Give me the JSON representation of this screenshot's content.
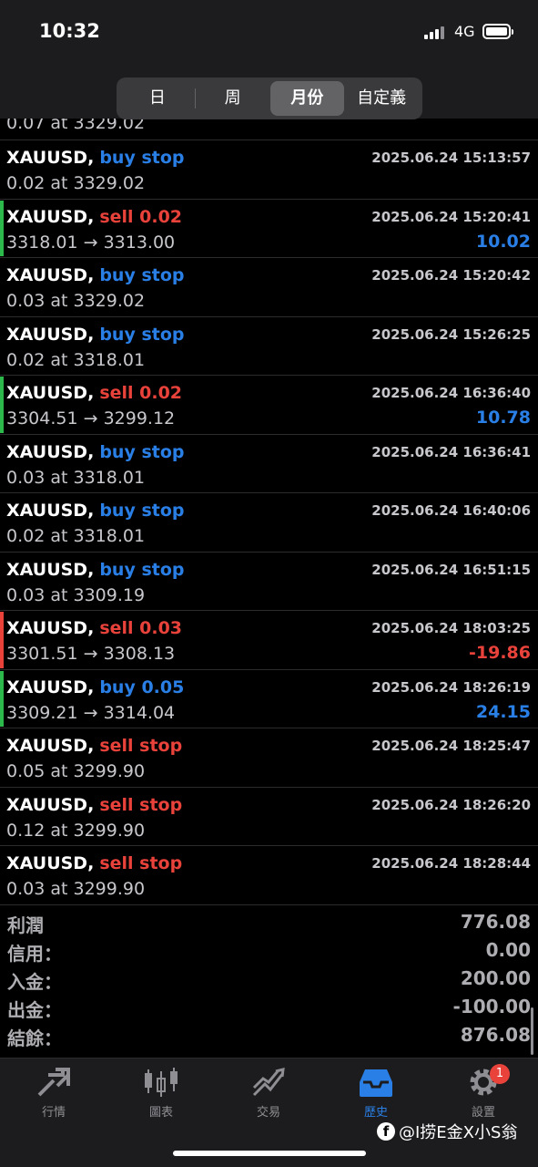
{
  "status_bar": {
    "time": "10:32",
    "network": "4G"
  },
  "period_tabs": [
    {
      "label": "日",
      "active": false
    },
    {
      "label": "周",
      "active": false
    },
    {
      "label": "月份",
      "active": true
    },
    {
      "label": "自定義",
      "active": false
    }
  ],
  "partial_row": {
    "detail": "0.07 at 3329.02"
  },
  "orders": [
    {
      "symbol": "XAUUSD,",
      "type": "buy stop",
      "type_color": "blue",
      "date": "2025.06.24 15:13:57",
      "detail": "0.02 at 3329.02",
      "profit": "",
      "bar": ""
    },
    {
      "symbol": "XAUUSD,",
      "type": "sell 0.02",
      "type_color": "red",
      "date": "2025.06.24 15:20:41",
      "detail": "3318.01 → 3313.00",
      "profit": "10.02",
      "profit_color": "blue",
      "bar": "#2db84c"
    },
    {
      "symbol": "XAUUSD,",
      "type": "buy stop",
      "type_color": "blue",
      "date": "2025.06.24 15:20:42",
      "detail": "0.03 at 3329.02",
      "profit": "",
      "bar": ""
    },
    {
      "symbol": "XAUUSD,",
      "type": "buy stop",
      "type_color": "blue",
      "date": "2025.06.24 15:26:25",
      "detail": "0.02 at 3318.01",
      "profit": "",
      "bar": ""
    },
    {
      "symbol": "XAUUSD,",
      "type": "sell 0.02",
      "type_color": "red",
      "date": "2025.06.24 16:36:40",
      "detail": "3304.51 → 3299.12",
      "profit": "10.78",
      "profit_color": "blue",
      "bar": "#2db84c"
    },
    {
      "symbol": "XAUUSD,",
      "type": "buy stop",
      "type_color": "blue",
      "date": "2025.06.24 16:36:41",
      "detail": "0.03 at 3318.01",
      "profit": "",
      "bar": ""
    },
    {
      "symbol": "XAUUSD,",
      "type": "buy stop",
      "type_color": "blue",
      "date": "2025.06.24 16:40:06",
      "detail": "0.02 at 3318.01",
      "profit": "",
      "bar": ""
    },
    {
      "symbol": "XAUUSD,",
      "type": "buy stop",
      "type_color": "blue",
      "date": "2025.06.24 16:51:15",
      "detail": "0.03 at 3309.19",
      "profit": "",
      "bar": ""
    },
    {
      "symbol": "XAUUSD,",
      "type": "sell 0.03",
      "type_color": "red",
      "date": "2025.06.24 18:03:25",
      "detail": "3301.51 → 3308.13",
      "profit": "-19.86",
      "profit_color": "red",
      "bar": "#e8423b"
    },
    {
      "symbol": "XAUUSD,",
      "type": "buy 0.05",
      "type_color": "blue",
      "date": "2025.06.24 18:26:19",
      "detail": "3309.21 → 3314.04",
      "profit": "24.15",
      "profit_color": "blue",
      "bar": "#2db84c"
    },
    {
      "symbol": "XAUUSD,",
      "type": "sell stop",
      "type_color": "red",
      "date": "2025.06.24 18:25:47",
      "detail": "0.05 at 3299.90",
      "profit": "",
      "bar": ""
    },
    {
      "symbol": "XAUUSD,",
      "type": "sell stop",
      "type_color": "red",
      "date": "2025.06.24 18:26:20",
      "detail": "0.12 at 3299.90",
      "profit": "",
      "bar": ""
    },
    {
      "symbol": "XAUUSD,",
      "type": "sell stop",
      "type_color": "red",
      "date": "2025.06.24 18:28:44",
      "detail": "0.03 at 3299.90",
      "profit": "",
      "bar": ""
    }
  ],
  "summary": [
    {
      "label": "利潤",
      "value": "776.08"
    },
    {
      "label": "信用：",
      "value": "0.00"
    },
    {
      "label": "入金：",
      "value": "200.00"
    },
    {
      "label": "出金：",
      "value": "-100.00"
    },
    {
      "label": "結餘：",
      "value": "876.08"
    }
  ],
  "tabbar": {
    "items": [
      {
        "label": "行情",
        "icon": "quotes-icon",
        "active": false
      },
      {
        "label": "圖表",
        "icon": "chart-icon",
        "active": false
      },
      {
        "label": "交易",
        "icon": "trade-icon",
        "active": false
      },
      {
        "label": "歷史",
        "icon": "history-icon",
        "active": true
      },
      {
        "label": "設置",
        "icon": "settings-icon",
        "active": false,
        "badge": "1"
      }
    ]
  },
  "watermark": {
    "text": "@I捞E金X小S翁",
    "logo": "f"
  },
  "colors": {
    "blue": "#2a7fe6",
    "red": "#e8423b",
    "green": "#2db84c",
    "muted": "#c7c7cc"
  }
}
